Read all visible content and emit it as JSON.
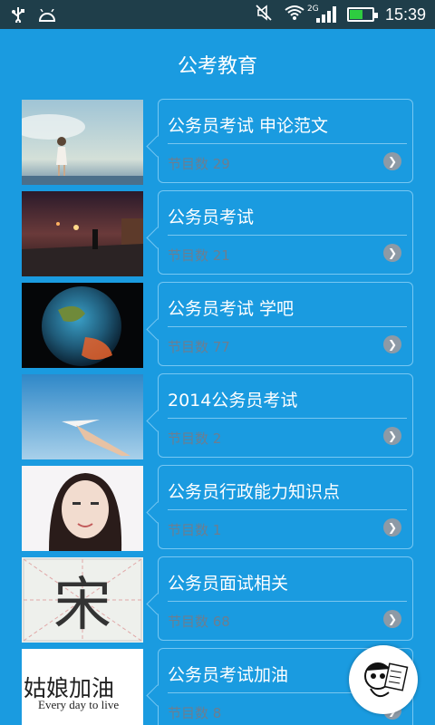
{
  "status": {
    "time": "15:39",
    "network": "2G",
    "battery_level": 0.6,
    "icons": [
      "usb-icon",
      "android-icon",
      "mute-icon",
      "wifi-icon",
      "signal-icon",
      "battery-icon"
    ]
  },
  "header": {
    "title": "公考教育"
  },
  "items": [
    {
      "title": "公务员考试 申论范文",
      "count": "节目数 29"
    },
    {
      "title": "公务员考试",
      "count": "节目数 21"
    },
    {
      "title": "公务员考试 学吧",
      "count": "节目数 77"
    },
    {
      "title": "2014公务员考试",
      "count": "节目数 2"
    },
    {
      "title": "公务员行政能力知识点",
      "count": "节目数 1"
    },
    {
      "title": "公务员面试相关",
      "count": "节目数 68"
    },
    {
      "title": "公务员考试加油",
      "count": "节目数 8"
    }
  ],
  "thumb_text": {
    "song": "宋",
    "cheer_cn": "姑娘加油",
    "cheer_en": "Every day to live"
  },
  "colors": {
    "background": "#1a9be0",
    "statusbar": "#1f3e4a",
    "count_text": "#6c7e90"
  }
}
